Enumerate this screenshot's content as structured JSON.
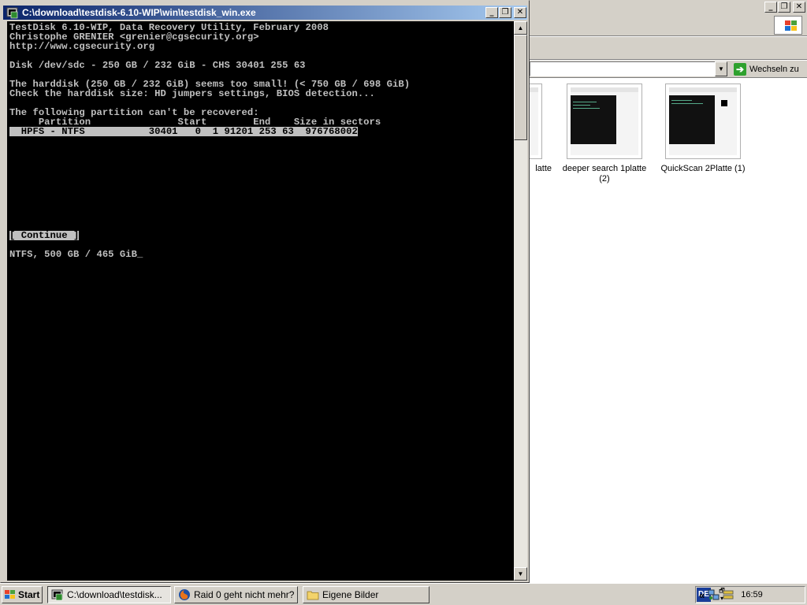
{
  "console": {
    "title": "C:\\download\\testdisk-6.10-WIP\\win\\testdisk_win.exe",
    "lines": [
      "TestDisk 6.10-WIP, Data Recovery Utility, February 2008",
      "Christophe GRENIER <grenier@cgsecurity.org>",
      "http://www.cgsecurity.org",
      "",
      "Disk /dev/sdc - 250 GB / 232 GiB - CHS 30401 255 63",
      "",
      "The harddisk (250 GB / 232 GiB) seems too small! (< 750 GB / 698 GiB)",
      "Check the harddisk size: HD jumpers settings, BIOS detection...",
      "",
      "The following partition can't be recovered:",
      "     Partition               Start        End    Size in sectors"
    ],
    "partition_row": "  HPFS - NTFS           30401   0  1 91201 253 63  976768002",
    "continue_label": "[ Continue ]",
    "status_line": "NTFS, 500 GB / 465 GiB_"
  },
  "explorer": {
    "go_label": "Wechseln zu",
    "thumbnails": [
      {
        "caption": "latte"
      },
      {
        "caption": "deeper search 1platte (2)"
      },
      {
        "caption": "QuickScan 2Platte (1)"
      }
    ]
  },
  "taskbar": {
    "start_label": "Start",
    "tasks": [
      {
        "label": "C:\\download\\testdisk..."
      },
      {
        "label": "Raid 0 geht nicht mehr? ..."
      },
      {
        "label": "Eigene Bilder"
      }
    ],
    "language": "DE",
    "chevron": "«",
    "clock": "16:59"
  }
}
